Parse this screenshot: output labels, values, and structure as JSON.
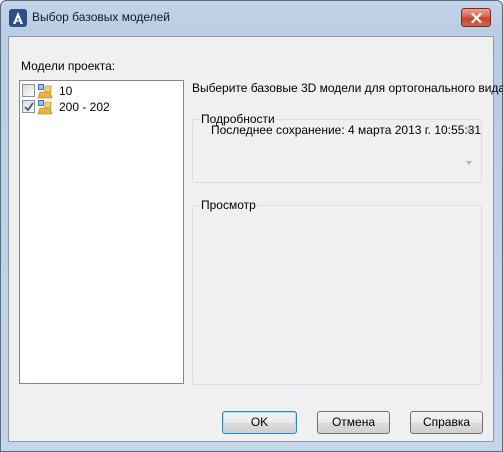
{
  "window": {
    "title": "Выбор базовых моделей"
  },
  "models_panel": {
    "label": "Модели проекта:",
    "items": [
      {
        "label": "10",
        "checked": false
      },
      {
        "label": "200 - 202",
        "checked": true
      }
    ]
  },
  "instruction": "Выберите базовые 3D модели для ортогонального вида.",
  "details": {
    "title": "Подробности",
    "text": "Последнее сохранение: 4 марта 2013 г. 10:55:31"
  },
  "preview": {
    "title": "Просмотр"
  },
  "buttons": {
    "ok": "OK",
    "cancel": "Отмена",
    "help": "Справка"
  },
  "colors": {
    "title_bar": "#c3d4e7",
    "client": "#f0f0f0",
    "close_button": "#c0412a"
  },
  "icons": {
    "app": "autocad-a-icon",
    "close": "close-icon",
    "model": "model-folder-icon",
    "scroll_up": "scroll-up-icon",
    "scroll_down": "scroll-down-icon"
  }
}
